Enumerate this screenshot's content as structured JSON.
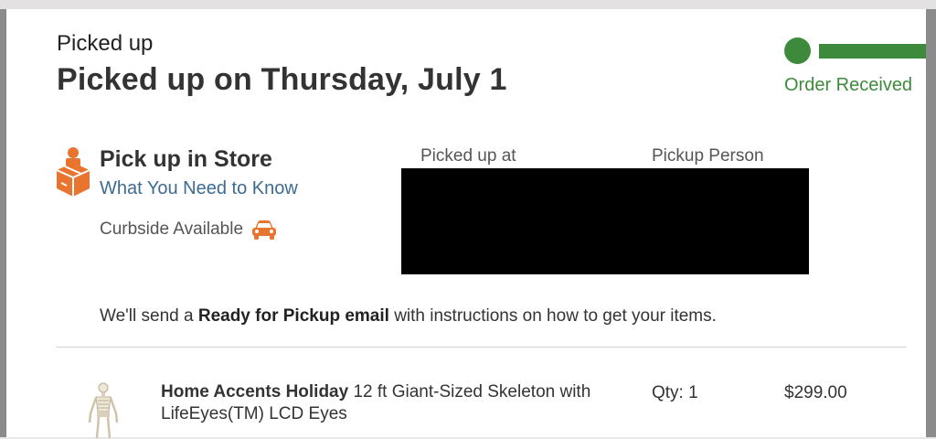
{
  "order": {
    "status_small": "Picked up",
    "status_title": "Picked up on Thursday, July 1"
  },
  "tracker": {
    "label": "Order Received",
    "color": "#3e8a3c"
  },
  "pickup": {
    "title": "Pick up in Store",
    "link": "What You Need to Know",
    "curbside": "Curbside Available",
    "icons": [
      "store-pickup-icon",
      "car-icon"
    ],
    "accent_color": "#e8752f"
  },
  "details": {
    "picked_up_at_label": "Picked up at",
    "pickup_person_label": "Pickup Person"
  },
  "notice": {
    "before": "We'll send a ",
    "bold": "Ready for Pickup email",
    "after": " with instructions on how to get your items."
  },
  "item": {
    "brand": "Home Accents Holiday",
    "description": " 12 ft Giant-Sized Skeleton with LifeEyes(TM) LCD Eyes",
    "qty": "Qty: 1",
    "price": "$299.00"
  }
}
